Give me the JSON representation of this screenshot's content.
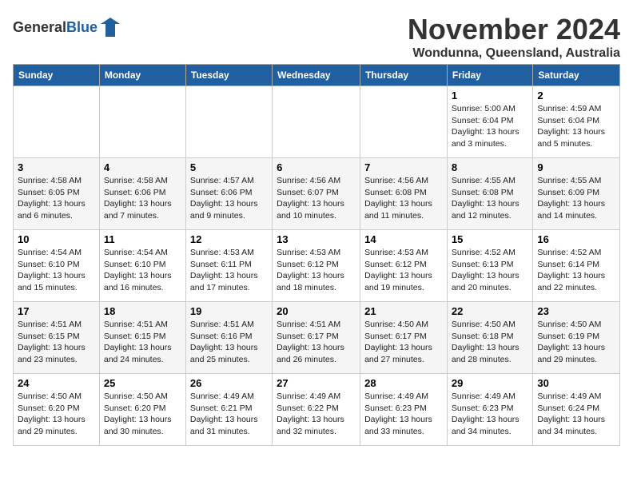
{
  "header": {
    "logo_general": "General",
    "logo_blue": "Blue",
    "month_title": "November 2024",
    "location": "Wondunna, Queensland, Australia"
  },
  "days_of_week": [
    "Sunday",
    "Monday",
    "Tuesday",
    "Wednesday",
    "Thursday",
    "Friday",
    "Saturday"
  ],
  "weeks": [
    [
      {
        "day": "",
        "info": ""
      },
      {
        "day": "",
        "info": ""
      },
      {
        "day": "",
        "info": ""
      },
      {
        "day": "",
        "info": ""
      },
      {
        "day": "",
        "info": ""
      },
      {
        "day": "1",
        "info": "Sunrise: 5:00 AM\nSunset: 6:04 PM\nDaylight: 13 hours and 3 minutes."
      },
      {
        "day": "2",
        "info": "Sunrise: 4:59 AM\nSunset: 6:04 PM\nDaylight: 13 hours and 5 minutes."
      }
    ],
    [
      {
        "day": "3",
        "info": "Sunrise: 4:58 AM\nSunset: 6:05 PM\nDaylight: 13 hours and 6 minutes."
      },
      {
        "day": "4",
        "info": "Sunrise: 4:58 AM\nSunset: 6:06 PM\nDaylight: 13 hours and 7 minutes."
      },
      {
        "day": "5",
        "info": "Sunrise: 4:57 AM\nSunset: 6:06 PM\nDaylight: 13 hours and 9 minutes."
      },
      {
        "day": "6",
        "info": "Sunrise: 4:56 AM\nSunset: 6:07 PM\nDaylight: 13 hours and 10 minutes."
      },
      {
        "day": "7",
        "info": "Sunrise: 4:56 AM\nSunset: 6:08 PM\nDaylight: 13 hours and 11 minutes."
      },
      {
        "day": "8",
        "info": "Sunrise: 4:55 AM\nSunset: 6:08 PM\nDaylight: 13 hours and 12 minutes."
      },
      {
        "day": "9",
        "info": "Sunrise: 4:55 AM\nSunset: 6:09 PM\nDaylight: 13 hours and 14 minutes."
      }
    ],
    [
      {
        "day": "10",
        "info": "Sunrise: 4:54 AM\nSunset: 6:10 PM\nDaylight: 13 hours and 15 minutes."
      },
      {
        "day": "11",
        "info": "Sunrise: 4:54 AM\nSunset: 6:10 PM\nDaylight: 13 hours and 16 minutes."
      },
      {
        "day": "12",
        "info": "Sunrise: 4:53 AM\nSunset: 6:11 PM\nDaylight: 13 hours and 17 minutes."
      },
      {
        "day": "13",
        "info": "Sunrise: 4:53 AM\nSunset: 6:12 PM\nDaylight: 13 hours and 18 minutes."
      },
      {
        "day": "14",
        "info": "Sunrise: 4:53 AM\nSunset: 6:12 PM\nDaylight: 13 hours and 19 minutes."
      },
      {
        "day": "15",
        "info": "Sunrise: 4:52 AM\nSunset: 6:13 PM\nDaylight: 13 hours and 20 minutes."
      },
      {
        "day": "16",
        "info": "Sunrise: 4:52 AM\nSunset: 6:14 PM\nDaylight: 13 hours and 22 minutes."
      }
    ],
    [
      {
        "day": "17",
        "info": "Sunrise: 4:51 AM\nSunset: 6:15 PM\nDaylight: 13 hours and 23 minutes."
      },
      {
        "day": "18",
        "info": "Sunrise: 4:51 AM\nSunset: 6:15 PM\nDaylight: 13 hours and 24 minutes."
      },
      {
        "day": "19",
        "info": "Sunrise: 4:51 AM\nSunset: 6:16 PM\nDaylight: 13 hours and 25 minutes."
      },
      {
        "day": "20",
        "info": "Sunrise: 4:51 AM\nSunset: 6:17 PM\nDaylight: 13 hours and 26 minutes."
      },
      {
        "day": "21",
        "info": "Sunrise: 4:50 AM\nSunset: 6:17 PM\nDaylight: 13 hours and 27 minutes."
      },
      {
        "day": "22",
        "info": "Sunrise: 4:50 AM\nSunset: 6:18 PM\nDaylight: 13 hours and 28 minutes."
      },
      {
        "day": "23",
        "info": "Sunrise: 4:50 AM\nSunset: 6:19 PM\nDaylight: 13 hours and 29 minutes."
      }
    ],
    [
      {
        "day": "24",
        "info": "Sunrise: 4:50 AM\nSunset: 6:20 PM\nDaylight: 13 hours and 29 minutes."
      },
      {
        "day": "25",
        "info": "Sunrise: 4:50 AM\nSunset: 6:20 PM\nDaylight: 13 hours and 30 minutes."
      },
      {
        "day": "26",
        "info": "Sunrise: 4:49 AM\nSunset: 6:21 PM\nDaylight: 13 hours and 31 minutes."
      },
      {
        "day": "27",
        "info": "Sunrise: 4:49 AM\nSunset: 6:22 PM\nDaylight: 13 hours and 32 minutes."
      },
      {
        "day": "28",
        "info": "Sunrise: 4:49 AM\nSunset: 6:23 PM\nDaylight: 13 hours and 33 minutes."
      },
      {
        "day": "29",
        "info": "Sunrise: 4:49 AM\nSunset: 6:23 PM\nDaylight: 13 hours and 34 minutes."
      },
      {
        "day": "30",
        "info": "Sunrise: 4:49 AM\nSunset: 6:24 PM\nDaylight: 13 hours and 34 minutes."
      }
    ]
  ]
}
